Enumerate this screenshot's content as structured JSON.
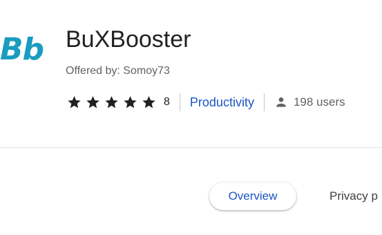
{
  "extension": {
    "logo_text": "Bb",
    "name": "BuXBooster",
    "offered_by": "Offered by: Somoy73",
    "rating": 5,
    "rating_count": "8",
    "category": "Productivity",
    "users": "198 users"
  },
  "tabs": [
    {
      "label": "Overview",
      "selected": true
    },
    {
      "label": "Privacy p",
      "selected": false
    }
  ],
  "colors": {
    "logo": "#1a9cc0",
    "accent": "#1a56c4",
    "star": "#202124"
  },
  "icons": {
    "star": "star-icon",
    "users": "person-icon"
  }
}
